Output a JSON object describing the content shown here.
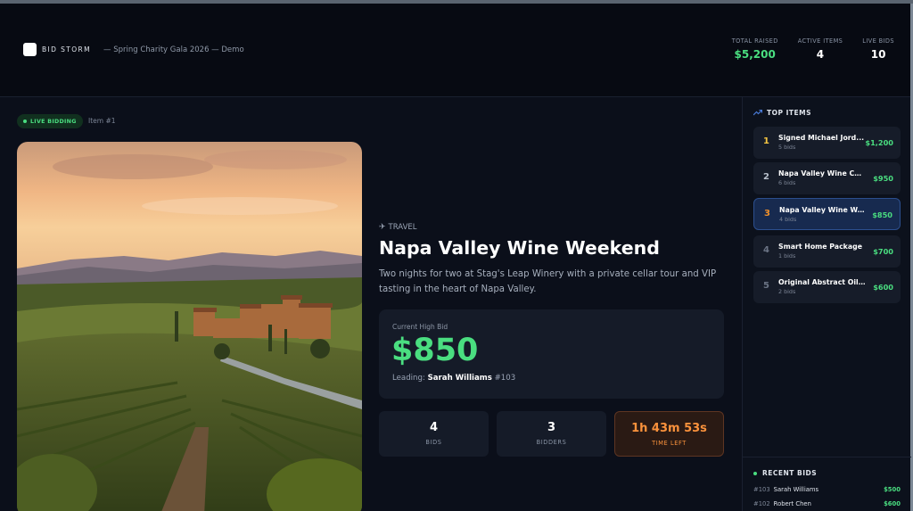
{
  "header": {
    "brand": "BID STORM",
    "event": "— Spring Charity Gala 2026 — Demo",
    "stats": [
      {
        "label": "TOTAL RAISED",
        "value": "$5,200"
      },
      {
        "label": "ACTIVE ITEMS",
        "value": "4"
      },
      {
        "label": "LIVE BIDS",
        "value": "10"
      }
    ]
  },
  "main": {
    "badge": "LIVE BIDDING",
    "item_number": "Item #1",
    "category": "TRAVEL",
    "title": "Napa Valley Wine Weekend",
    "description": "Two nights for two at Stag's Leap Winery with a private cellar tour and VIP tasting in the heart of Napa Valley.",
    "bid": {
      "label": "Current High Bid",
      "amount": "$850",
      "leading_prefix": "Leading: ",
      "leading_name": "Sarah Williams",
      "leading_number": " #103"
    },
    "mini_stats": [
      {
        "value": "4",
        "label": "BIDS"
      },
      {
        "value": "3",
        "label": "BIDDERS"
      },
      {
        "value": "1h 43m 53s",
        "label": "TIME LEFT"
      }
    ]
  },
  "sidebar": {
    "top_heading": "TOP ITEMS",
    "top_items": [
      {
        "rank": "1",
        "name": "Signed Michael Jord...",
        "bids": "5 bids",
        "price": "$1,200"
      },
      {
        "rank": "2",
        "name": "Napa Valley Wine Coll...",
        "bids": "6 bids",
        "price": "$950"
      },
      {
        "rank": "3",
        "name": "Napa Valley Wine We...",
        "bids": "4 bids",
        "price": "$850"
      },
      {
        "rank": "4",
        "name": "Smart Home Package",
        "bids": "1 bids",
        "price": "$700"
      },
      {
        "rank": "5",
        "name": "Original Abstract Oil P...",
        "bids": "2 bids",
        "price": "$600"
      }
    ],
    "recent_heading": "RECENT BIDS",
    "recent_bids": [
      {
        "number": "#103",
        "name": "Sarah Williams",
        "amount": "$500"
      },
      {
        "number": "#102",
        "name": "Robert Chen",
        "amount": "$600"
      }
    ]
  },
  "colors": {
    "accent_green": "#4ade80",
    "timer_orange": "#fb923c",
    "gold_rank": "#f5c542",
    "bronze_rank": "#f0902a",
    "active_highlight": "#172a4f"
  },
  "icons": {
    "category": "airplane-icon",
    "top_items": "trending-up-icon",
    "live": "live-dot-icon"
  }
}
